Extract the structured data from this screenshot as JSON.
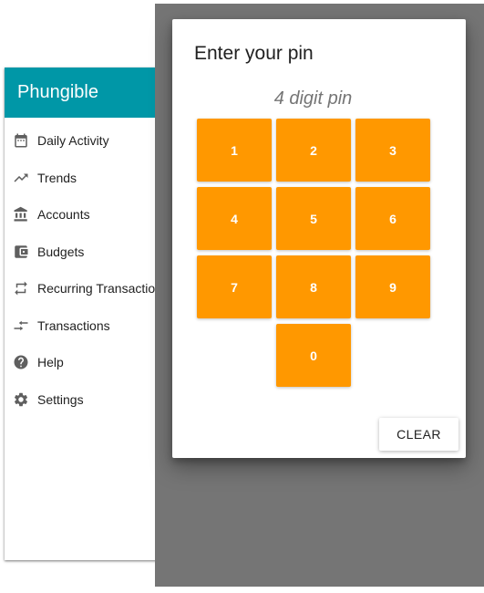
{
  "sidebar": {
    "title": "Phungible",
    "items": [
      {
        "label": "Daily Activity",
        "icon": "calendar-icon"
      },
      {
        "label": "Trends",
        "icon": "trending-up-icon"
      },
      {
        "label": "Accounts",
        "icon": "bank-icon"
      },
      {
        "label": "Budgets",
        "icon": "wallet-icon"
      },
      {
        "label": "Recurring Transactions",
        "icon": "repeat-icon"
      },
      {
        "label": "Transactions",
        "icon": "transfer-icon"
      },
      {
        "label": "Help",
        "icon": "help-icon"
      },
      {
        "label": "Settings",
        "icon": "gear-icon"
      }
    ]
  },
  "dialog": {
    "title": "Enter your pin",
    "pin_placeholder": "4 digit pin",
    "keys": [
      "1",
      "2",
      "3",
      "4",
      "5",
      "6",
      "7",
      "8",
      "9",
      "0"
    ],
    "clear_label": "CLEAR"
  },
  "colors": {
    "header": "#0097a7",
    "key": "#ff9800",
    "overlay": "#757575"
  }
}
